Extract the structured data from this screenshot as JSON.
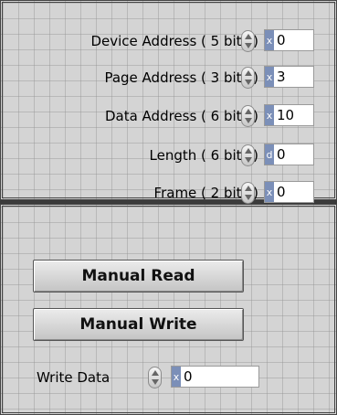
{
  "registers": [
    {
      "label": "Device Address ( 5 bits )",
      "radix": "x",
      "value": "0"
    },
    {
      "label": "Page Address ( 3 bits )",
      "radix": "x",
      "value": "3"
    },
    {
      "label": "Data Address ( 6 bits )",
      "radix": "x",
      "value": "10"
    },
    {
      "label": "Length ( 6 bits )",
      "radix": "d",
      "value": "0"
    },
    {
      "label": "Frame ( 2 bits )",
      "radix": "x",
      "value": "0"
    }
  ],
  "buttons": {
    "read_label": "Manual Read",
    "write_label": "Manual Write"
  },
  "write_data": {
    "label": "Write Data",
    "radix": "x",
    "value": "0"
  },
  "colors": {
    "panel_bg": "#d4d4d4",
    "radix_bg": "#7b8fb8"
  }
}
